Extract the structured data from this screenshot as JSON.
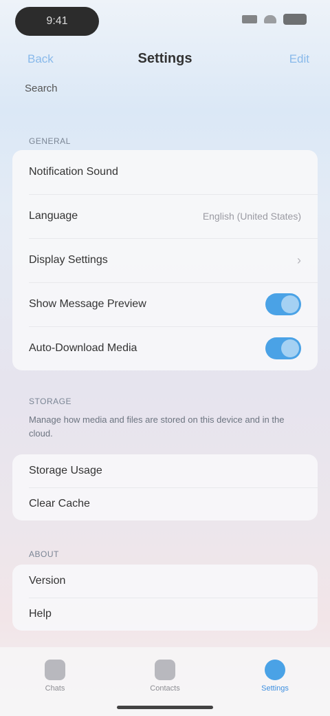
{
  "status_bar": {
    "time": "9:41"
  },
  "nav": {
    "back_label": "Back",
    "title": "Settings",
    "action_label": "Edit"
  },
  "search": {
    "label": "Search"
  },
  "section_general": {
    "header": "General",
    "rows": [
      {
        "label": "Notification Sound",
        "type": "plain"
      },
      {
        "label": "Language",
        "type": "value",
        "value": "English (United States)"
      },
      {
        "label": "Display Settings",
        "type": "chevron"
      },
      {
        "label": "Show Message Preview",
        "type": "toggle",
        "on": true
      },
      {
        "label": "Auto-Download Media",
        "type": "toggle",
        "on": true
      }
    ]
  },
  "section_storage": {
    "header": "Storage",
    "footnote": "Manage how media and files are stored on this device and in the cloud.",
    "rows": [
      {
        "label": "Storage Usage"
      },
      {
        "label": "Clear Cache"
      }
    ]
  },
  "section_about": {
    "header": "About",
    "rows": [
      {
        "label": "Version"
      },
      {
        "label": "Help"
      }
    ]
  },
  "tab_bar": {
    "tabs": [
      {
        "label": "Chats",
        "active": false
      },
      {
        "label": "Contacts",
        "active": false
      },
      {
        "label": "Settings",
        "active": true
      }
    ]
  },
  "colors": {
    "accent": "#4aa2e6"
  }
}
